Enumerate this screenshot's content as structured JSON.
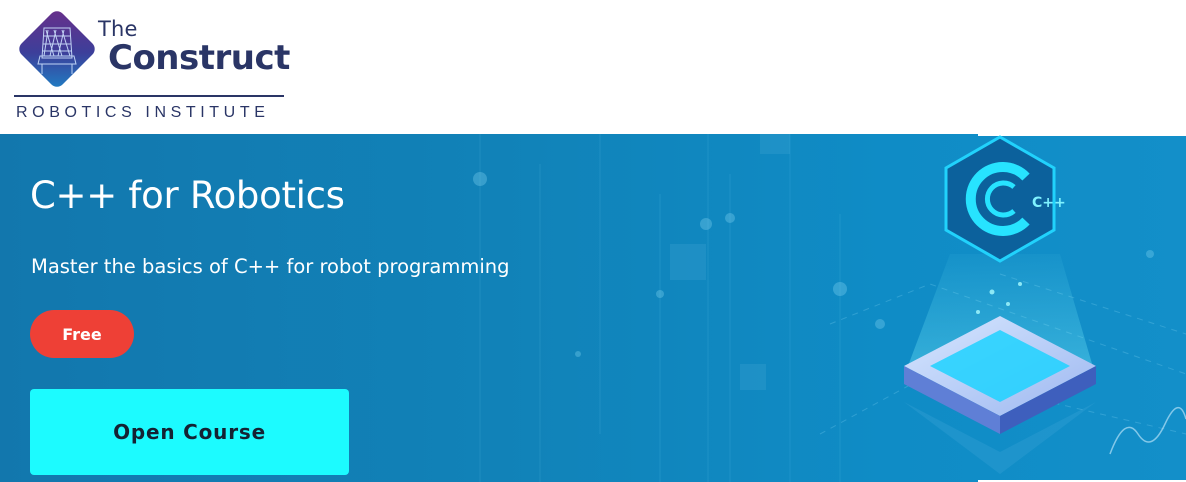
{
  "header": {
    "brand_the": "The",
    "brand_name": "Construct",
    "brand_sub": "ROBOTICS INSTITUTE"
  },
  "banner": {
    "title": "C++ for Robotics",
    "subtitle": "Master the basics of C++ for robot programming",
    "badge": "Free",
    "cta_label": "Open Course",
    "illustration_text": "C++"
  },
  "colors": {
    "brand_navy": "#2a3566",
    "banner_blue": "#1183b9",
    "badge_red": "#ee4036",
    "cta_cyan": "#1cfbff",
    "cta_text": "#142233"
  },
  "icons": {
    "logo": "construct-chair-logo-icon",
    "illustration": "cpp-hologram-icon"
  }
}
